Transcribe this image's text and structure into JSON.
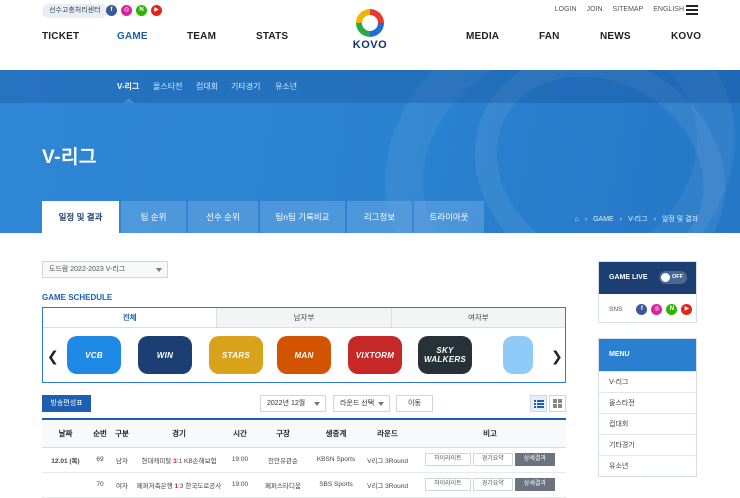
{
  "colors": {
    "primary": "#1d5fb3",
    "hero": "#2b82d0",
    "navy": "#1b3f73",
    "score": "#c62828"
  },
  "topbar": {
    "center_label": "선수고충처리센터",
    "sns": [
      {
        "icon": "facebook-icon",
        "glyph": "f",
        "color": "#3b5998"
      },
      {
        "icon": "instagram-icon",
        "glyph": "◎",
        "color": "#d6249f"
      },
      {
        "icon": "naver-icon",
        "glyph": "N",
        "color": "#2db400"
      },
      {
        "icon": "youtube-icon",
        "glyph": "▶",
        "color": "#e62117"
      }
    ],
    "util_links": [
      "LOGIN",
      "JOIN",
      "SITEMAP",
      "ENGLISH"
    ]
  },
  "gnb": {
    "left": [
      "TICKET",
      "GAME",
      "TEAM",
      "STATS"
    ],
    "right": [
      "MEDIA",
      "FAN",
      "NEWS",
      "KOVO"
    ],
    "logo_text": "KOVO"
  },
  "subnav": [
    "V-리그",
    "올스타전",
    "컵대회",
    "기타경기",
    "유소년"
  ],
  "hero": {
    "title": "V-리그"
  },
  "tabs": [
    "일정 및 결과",
    "팀 순위",
    "선수 순위",
    "팀n팀 기록비교",
    "리그정보",
    "트라이아웃"
  ],
  "breadcrumb": [
    "GAME",
    "V-리그",
    "일정 및 결과"
  ],
  "season_select": "도드람 2022-2023 V-리그",
  "schedule_title": "GAME SCHEDULE",
  "panel_tabs": [
    "전체",
    "남자부",
    "여자부"
  ],
  "team_logos": [
    {
      "text": "VCB",
      "bg": "#1e88e5",
      "icon": "team-logo-1-icon"
    },
    {
      "text": "WIN",
      "bg": "#1b3f73",
      "icon": "team-logo-2-icon"
    },
    {
      "text": "STARS",
      "bg": "#d9a21b",
      "icon": "team-logo-3-icon"
    },
    {
      "text": "MAN",
      "bg": "#d35400",
      "icon": "team-logo-4-icon"
    },
    {
      "text": "VIXTORM",
      "bg": "#c62828",
      "icon": "team-logo-5-icon"
    },
    {
      "text": "SKY WALKERS",
      "bg": "#263238",
      "icon": "team-logo-6-icon"
    },
    {
      "text": "",
      "bg": "#90caf9",
      "icon": "team-logo-7-icon"
    }
  ],
  "controls": {
    "broadcast_button": "방송편성표",
    "month_select": "2022년 12월",
    "round_select": "라운드 선택",
    "go_button": "이동"
  },
  "table": {
    "headers": [
      "날짜",
      "순번",
      "구분",
      "경기",
      "시간",
      "구장",
      "생중계",
      "라운드",
      "비고"
    ],
    "rows": [
      {
        "date": "12.01 (목)",
        "no": "69",
        "gender": "남자",
        "home": "현대캐피탈",
        "hs": "3",
        "as": "1",
        "away": "KB손해보험",
        "time": "19:00",
        "venue": "천안유관순",
        "tv": "KBSN Sports",
        "round": "V리그 3Round",
        "b1": "하이라이트",
        "b2": "경기요약",
        "b3": "상세결과"
      },
      {
        "date": "",
        "no": "70",
        "gender": "여자",
        "home": "페퍼저축은행",
        "hs": "1",
        "as": "3",
        "away": "한국도로공사",
        "time": "19:00",
        "venue": "페퍼스타디움",
        "tv": "SBS Sports",
        "round": "V리그 3Round",
        "b1": "하이라이트",
        "b2": "경기요약",
        "b3": "상세결과"
      }
    ]
  },
  "sidebar": {
    "game_live": "GAME LIVE",
    "toggle": "OFF",
    "sns_label": "SNS",
    "menu_title": "MENU",
    "menu_items": [
      "V-리그",
      "올스타전",
      "컵대회",
      "기타경기",
      "유소년"
    ]
  }
}
